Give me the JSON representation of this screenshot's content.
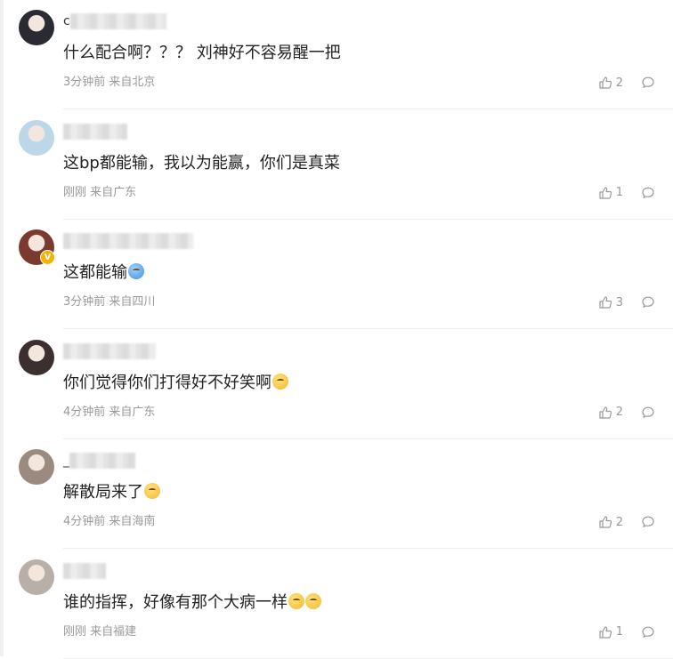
{
  "comments": [
    {
      "name_prefix": "c",
      "content": "什么配合啊？？？ 刘神好不容易醒一把",
      "emojis": [],
      "meta": "3分钟前 来自北京",
      "likes": "2",
      "verified": false,
      "avatar_color": "#2a2a33"
    },
    {
      "name_prefix": "",
      "content": "这bp都能输，我以为能赢，你们是真菜",
      "emojis": [],
      "meta": "刚刚 来自广东",
      "likes": "1",
      "verified": false,
      "avatar_color": "#bcd8e8"
    },
    {
      "name_prefix": "",
      "content": "这都能输",
      "emojis": [
        "blue"
      ],
      "meta": "3分钟前 来自四川",
      "likes": "3",
      "verified": true,
      "avatar_color": "#7a3b2e"
    },
    {
      "name_prefix": "",
      "content": "你们觉得你们打得好不好笑啊",
      "emojis": [
        "yellow"
      ],
      "meta": "4分钟前 来自广东",
      "likes": "2",
      "verified": false,
      "avatar_color": "#3b2f2f"
    },
    {
      "name_prefix": "_",
      "content": "解散局来了",
      "emojis": [
        "yellow"
      ],
      "meta": "4分钟前 来自海南",
      "likes": "2",
      "verified": false,
      "avatar_color": "#9a8a80"
    },
    {
      "name_prefix": "",
      "content": "谁的指挥，好像有那个大病一样",
      "emojis": [
        "yellow",
        "yellow"
      ],
      "meta": "刚刚 来自福建",
      "likes": "1",
      "verified": false,
      "avatar_color": "#b8b0a8"
    }
  ],
  "colors": {
    "meta_text": "#999999",
    "divider": "#ececec",
    "content_text": "#222222"
  },
  "icons": {
    "like": "thumbs-up-icon",
    "reply": "comment-bubble-icon"
  }
}
